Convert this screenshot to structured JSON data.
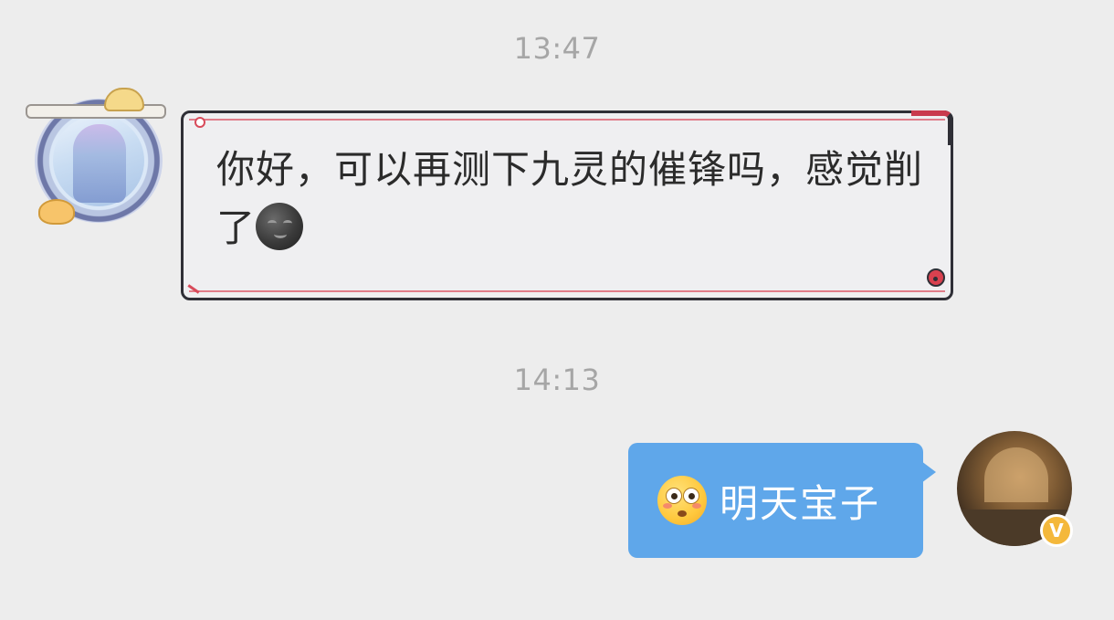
{
  "messages": [
    {
      "timestamp": "13:47",
      "direction": "incoming",
      "avatar_icon": "anime-character-framed-avatar-icon",
      "text": "你好，可以再测下九灵的催锋吗，感觉削了",
      "emoji": "new-moon-face-emoji"
    },
    {
      "timestamp": "14:13",
      "direction": "outgoing",
      "emoji": "flushed-face-emoji",
      "text": "明天宝子",
      "avatar_icon": "scenic-hall-avatar-icon",
      "badge": "V"
    }
  ],
  "colors": {
    "background": "#ededed",
    "timestamp_text": "#a6a6a6",
    "incoming_bubble": "#efeff1",
    "incoming_border": "#2f2f36",
    "incoming_accent": "#e07d8a",
    "outgoing_bubble": "#5fa7ea",
    "outgoing_text": "#ffffff",
    "badge": "#f4b83b"
  }
}
